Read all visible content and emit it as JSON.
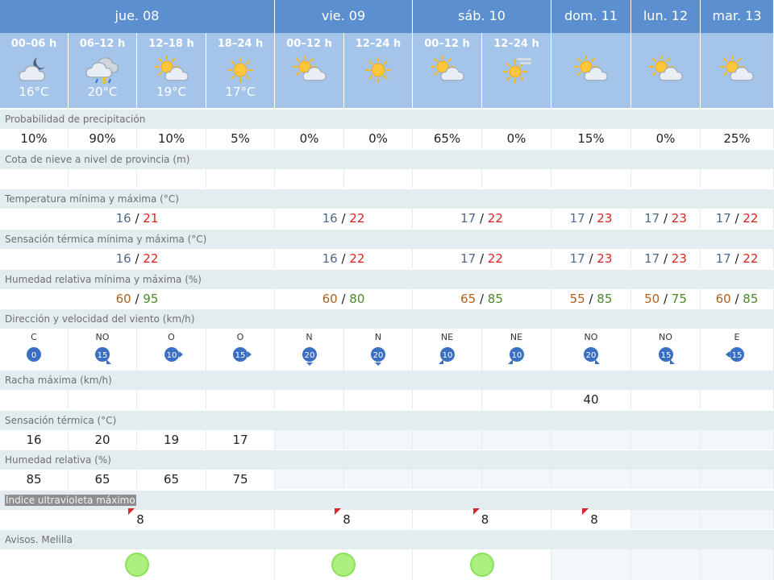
{
  "days": [
    {
      "label": "jue. 08",
      "start": 0,
      "span": 4
    },
    {
      "label": "vie. 09",
      "start": 4,
      "span": 2
    },
    {
      "label": "sáb. 10",
      "start": 6,
      "span": 2
    },
    {
      "label": "dom. 11",
      "start": 8,
      "span": 1
    },
    {
      "label": "lun. 12",
      "start": 9,
      "span": 1
    },
    {
      "label": "mar. 13",
      "start": 10,
      "span": 1
    }
  ],
  "periods": [
    {
      "label": "00–06 h",
      "icon": "night-cloud-icon",
      "temp": "16°C"
    },
    {
      "label": "06–12 h",
      "icon": "storm-rain-icon",
      "temp": "20°C"
    },
    {
      "label": "12–18 h",
      "icon": "sun-cloud-icon",
      "temp": "19°C"
    },
    {
      "label": "18–24 h",
      "icon": "sun-icon",
      "temp": "17°C"
    },
    {
      "label": "00–12 h",
      "icon": "sun-cloud-icon",
      "temp": ""
    },
    {
      "label": "12–24 h",
      "icon": "sun-icon",
      "temp": ""
    },
    {
      "label": "00–12 h",
      "icon": "sun-cloud-icon",
      "temp": ""
    },
    {
      "label": "12–24 h",
      "icon": "sun-haze-icon",
      "temp": ""
    },
    {
      "label": "",
      "icon": "sun-cloud-icon",
      "temp": ""
    },
    {
      "label": "",
      "icon": "sun-cloud-icon",
      "temp": ""
    },
    {
      "label": "",
      "icon": "sun-cloud-icon",
      "temp": ""
    }
  ],
  "labels": {
    "precip": "Probabilidad de precipitación",
    "snow": "Cota de nieve a nivel de provincia (m)",
    "temp": "Temperatura mínima y máxima (°C)",
    "sens": "Sensación térmica mínima y máxima (°C)",
    "hum": "Humedad relativa mínima y máxima (%)",
    "wind": "Dirección y velocidad del viento (km/h)",
    "gust": "Racha máxima (km/h)",
    "sensT": "Sensación térmica (°C)",
    "humR": "Humedad relativa (%)",
    "uv": "Índice ultravioleta máximo",
    "avisos": "Avisos. Melilla"
  },
  "precip": [
    "10%",
    "90%",
    "10%",
    "5%",
    "0%",
    "0%",
    "65%",
    "0%",
    "15%",
    "0%",
    "25%"
  ],
  "temp": [
    {
      "lo": "16",
      "hi": "21"
    },
    {
      "lo": "16",
      "hi": "22"
    },
    {
      "lo": "17",
      "hi": "22"
    },
    {
      "lo": "17",
      "hi": "23"
    },
    {
      "lo": "17",
      "hi": "23"
    },
    {
      "lo": "17",
      "hi": "22"
    }
  ],
  "sens": [
    {
      "lo": "16",
      "hi": "22"
    },
    {
      "lo": "16",
      "hi": "22"
    },
    {
      "lo": "17",
      "hi": "22"
    },
    {
      "lo": "17",
      "hi": "23"
    },
    {
      "lo": "17",
      "hi": "23"
    },
    {
      "lo": "17",
      "hi": "22"
    }
  ],
  "hum": [
    {
      "lo": "60",
      "hi": "95"
    },
    {
      "lo": "60",
      "hi": "80"
    },
    {
      "lo": "65",
      "hi": "85"
    },
    {
      "lo": "55",
      "hi": "85"
    },
    {
      "lo": "50",
      "hi": "75"
    },
    {
      "lo": "60",
      "hi": "85"
    }
  ],
  "wind": [
    {
      "dir": "C",
      "speed": "0"
    },
    {
      "dir": "NO",
      "speed": "15"
    },
    {
      "dir": "O",
      "speed": "10"
    },
    {
      "dir": "O",
      "speed": "15"
    },
    {
      "dir": "N",
      "speed": "20"
    },
    {
      "dir": "N",
      "speed": "20"
    },
    {
      "dir": "NE",
      "speed": "10"
    },
    {
      "dir": "NE",
      "speed": "10"
    },
    {
      "dir": "NO",
      "speed": "20"
    },
    {
      "dir": "NO",
      "speed": "15"
    },
    {
      "dir": "E",
      "speed": "15"
    }
  ],
  "gust": [
    "",
    "",
    "",
    "",
    "",
    "",
    "",
    "",
    "40",
    "",
    ""
  ],
  "sensT": [
    "16",
    "20",
    "19",
    "17"
  ],
  "humR": [
    "85",
    "65",
    "65",
    "75"
  ],
  "uv": [
    "8",
    "8",
    "8",
    "8"
  ],
  "avisos": [
    true,
    true,
    true,
    false,
    false,
    false
  ]
}
